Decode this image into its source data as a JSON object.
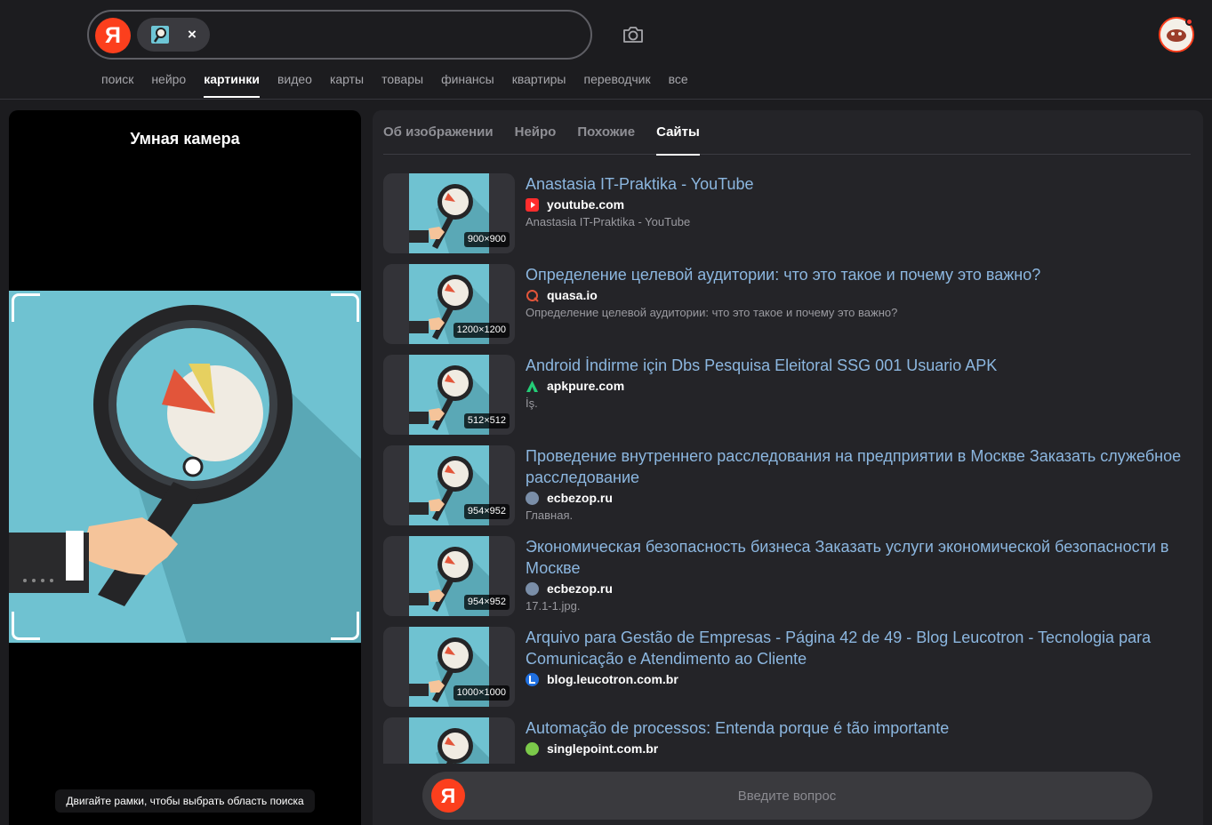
{
  "header": {
    "logo_letter": "Я",
    "chip_close": "×",
    "nav": [
      "поиск",
      "нейро",
      "картинки",
      "видео",
      "карты",
      "товары",
      "финансы",
      "квартиры",
      "переводчик",
      "все"
    ],
    "nav_active": "картинки"
  },
  "left_panel": {
    "title": "Умная камера",
    "hint": "Двигайте рамки, чтобы выбрать область поиска"
  },
  "tabs": [
    "Об изображении",
    "Нейро",
    "Похожие",
    "Сайты"
  ],
  "tab_active": "Сайты",
  "results": [
    {
      "title": "Anastasia IT-Praktika - YouTube",
      "site": "youtube.com",
      "desc": "Anastasia IT-Praktika - YouTube",
      "size": "900×900",
      "favicon": "youtube-icon"
    },
    {
      "title": "Определение целевой аудитории: что это такое и почему это важно?",
      "site": "quasa.io",
      "desc": "Определение целевой аудитории: что это такое и почему это важно?",
      "size": "1200×1200",
      "favicon": "quasa-icon"
    },
    {
      "title": "Android İndirme için Dbs Pesquisa Eleitoral SSG 001 Usuario APK",
      "site": "apkpure.com",
      "desc": "İş.",
      "size": "512×512",
      "favicon": "apkpure-icon"
    },
    {
      "title": "Проведение внутреннего расследования на предприятии в Москве Заказать служебное расследование",
      "site": "ecbezop.ru",
      "desc": "Главная.",
      "size": "954×952",
      "favicon": "ecbezop-icon"
    },
    {
      "title": "Экономическая безопасность бизнеса Заказать услуги экономической безопасности в Москве",
      "site": "ecbezop.ru",
      "desc": "17.1-1.jpg.",
      "size": "954×952",
      "favicon": "ecbezop-icon"
    },
    {
      "title": "Arquivo para Gestão de Empresas - Página 42 de 49 - Blog Leucotron - Tecnologia para Comunicação e Atendimento ao Cliente",
      "site": "blog.leucotron.com.br",
      "desc": "",
      "size": "1000×1000",
      "favicon": "leucotron-icon"
    },
    {
      "title": "Automação de processos: Entenda porque é tão importante",
      "site": "singlepoint.com.br",
      "desc": "",
      "size": "",
      "favicon": "singlepoint-icon"
    }
  ],
  "ask": {
    "logo_letter": "Я",
    "placeholder": "Введите вопрос"
  },
  "colors": {
    "brand_red": "#fc3f1d",
    "link": "#8cb7e0",
    "image_bg": "#6fc2d1"
  }
}
